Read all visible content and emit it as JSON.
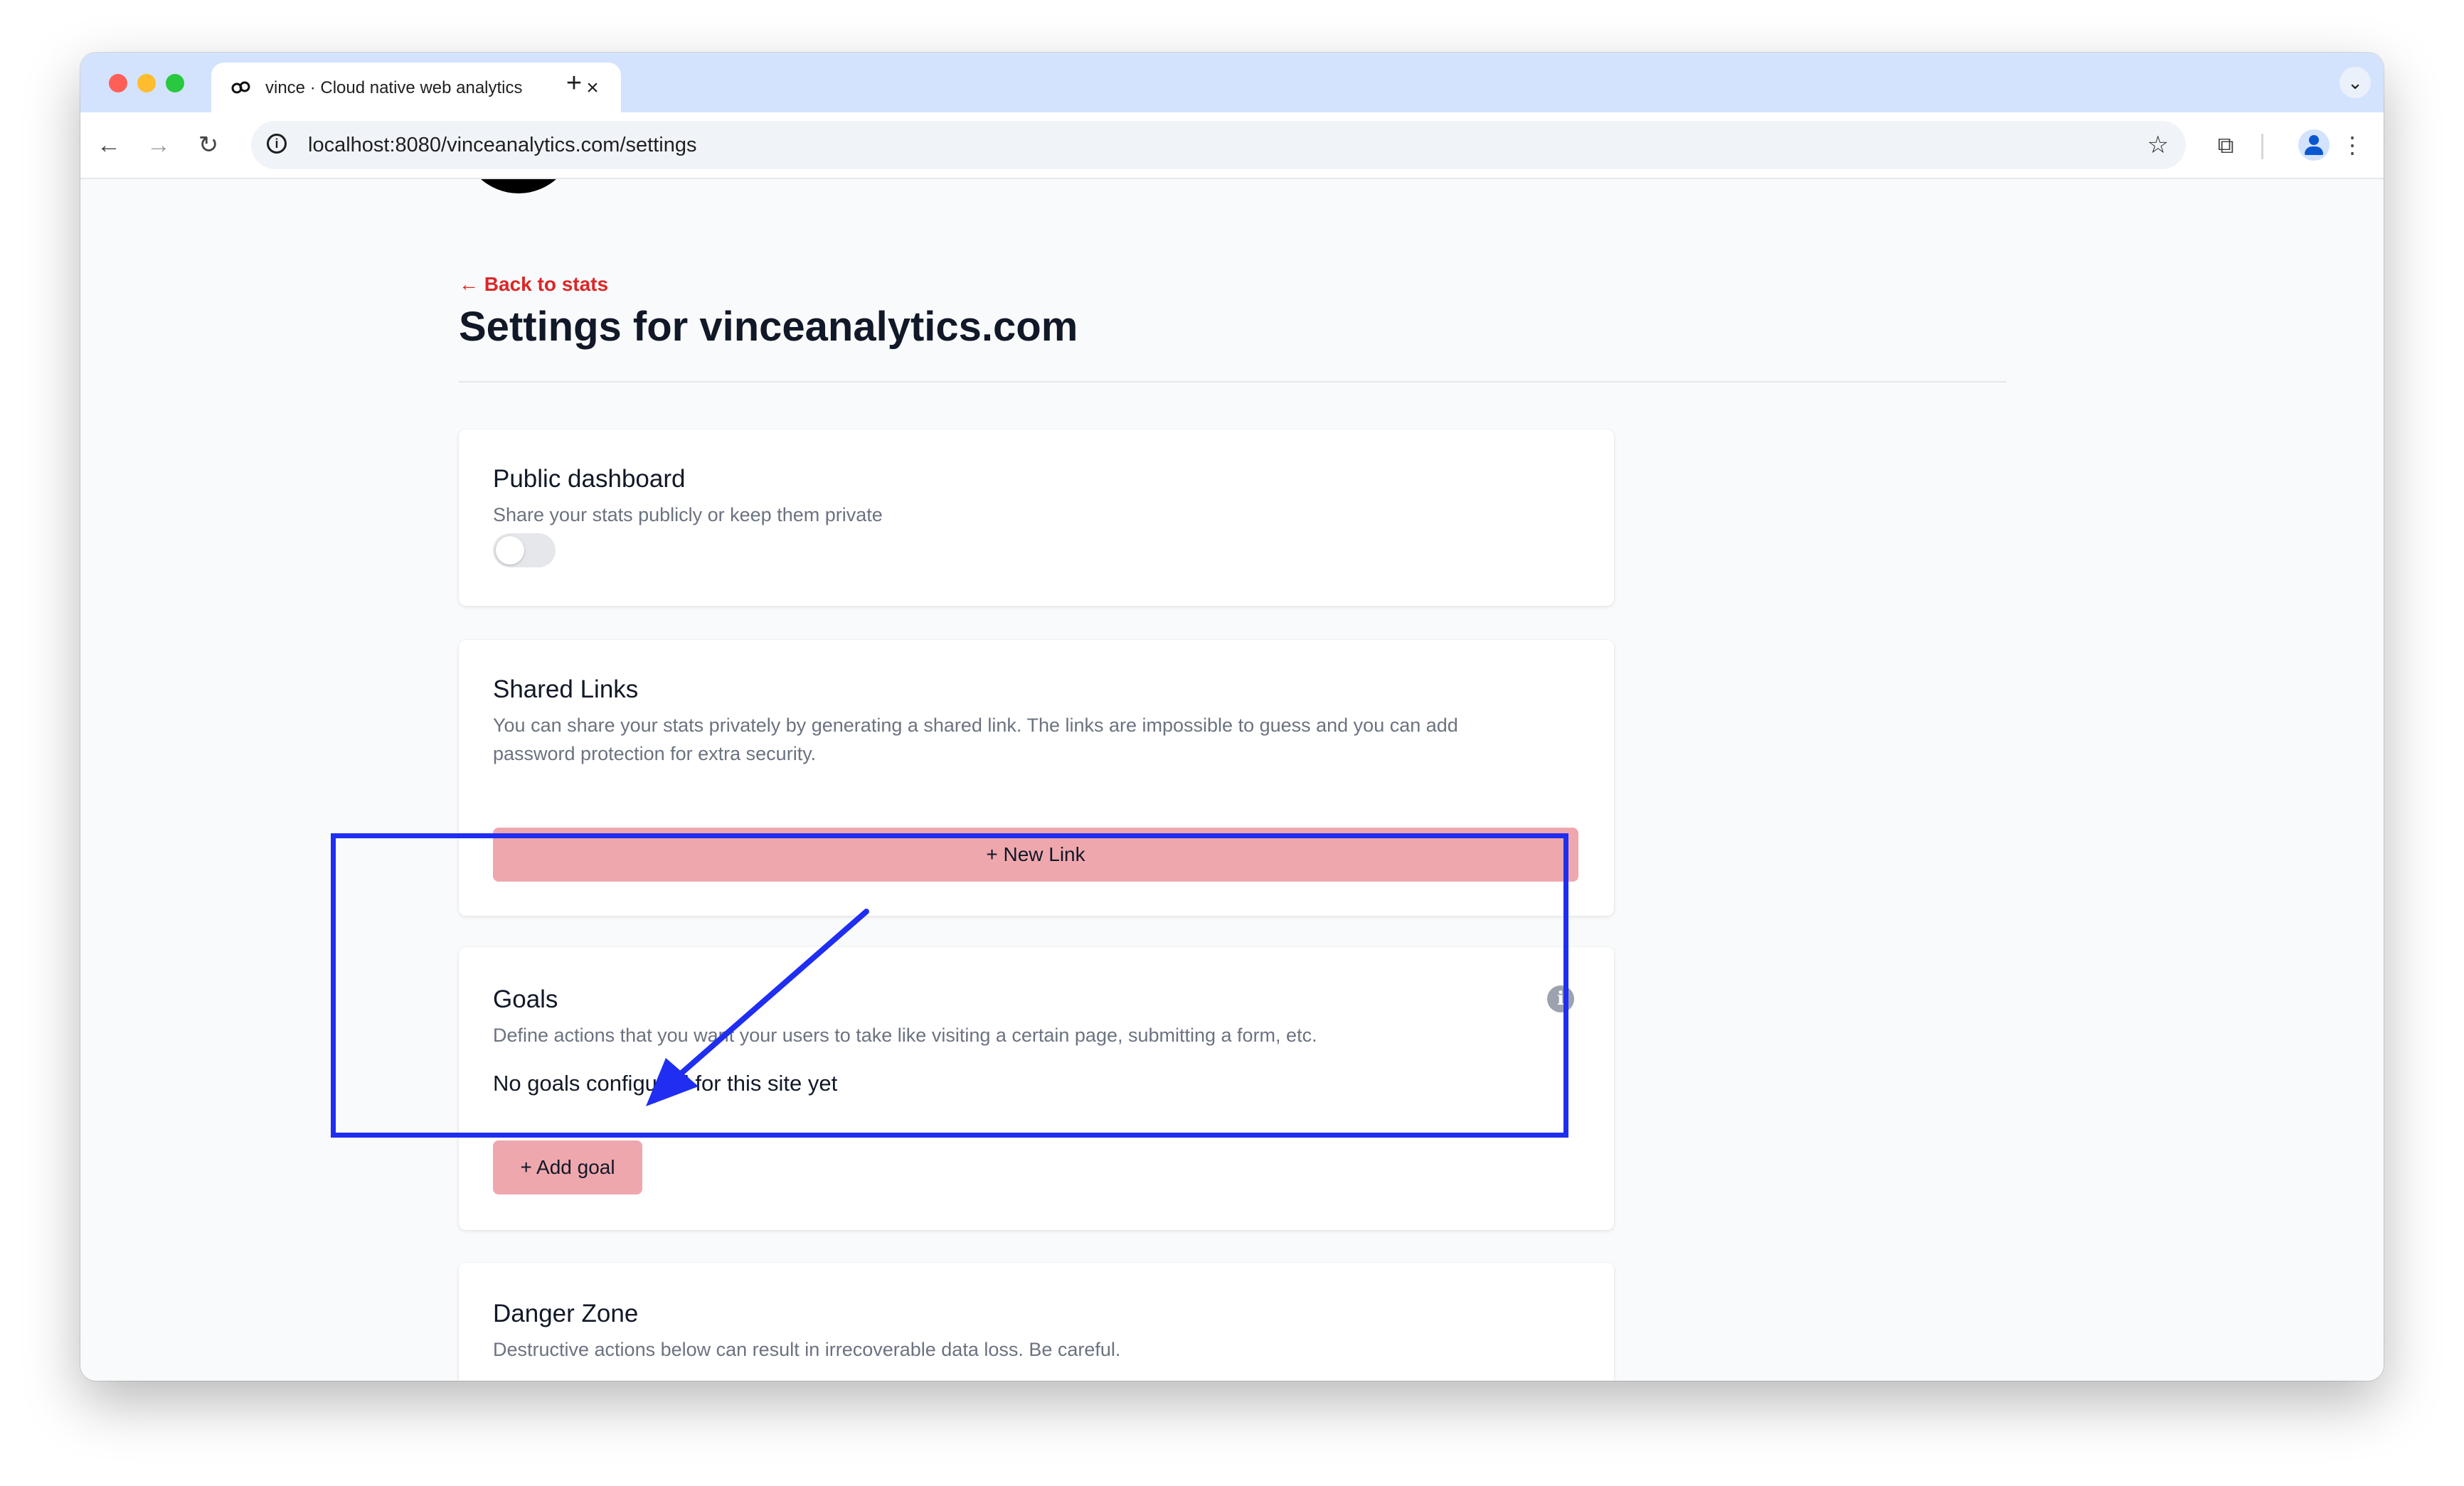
{
  "browser": {
    "tab_title": "vince · Cloud native web analytics",
    "tab_close": "×",
    "new_tab": "+",
    "tab_menu": "⌄",
    "url": "localhost:8080/vinceanalytics.com/settings",
    "back_icon": "←",
    "forward_icon": "→",
    "reload_icon": "↻",
    "star_icon": "☆",
    "extensions_icon": "⧉",
    "menu_icon": "⋮"
  },
  "page": {
    "back_link": "← Back to stats",
    "title": "Settings for vinceanalytics.com"
  },
  "public_dashboard": {
    "title": "Public dashboard",
    "description": "Share your stats publicly or keep them private",
    "enabled": false
  },
  "shared_links": {
    "title": "Shared Links",
    "description_line1": "You can share your stats privately by generating a shared link. The links are impossible to guess and you can add",
    "description_line2": "password protection for extra security.",
    "new_link_label": "+ New Link"
  },
  "goals": {
    "title": "Goals",
    "description": "Define actions that you want your users to take like visiting a certain page, submitting a form, etc.",
    "empty_text": "No goals configured for this site yet",
    "add_goal_label": "+ Add goal",
    "info_glyph": "i"
  },
  "danger_zone": {
    "title": "Danger Zone",
    "description": "Destructive actions below can result in irrecoverable data loss. Be careful."
  },
  "colors": {
    "accent_red": "#dc2626",
    "button_pink": "#efa7ae",
    "annotation_blue": "#1f2ef0"
  }
}
